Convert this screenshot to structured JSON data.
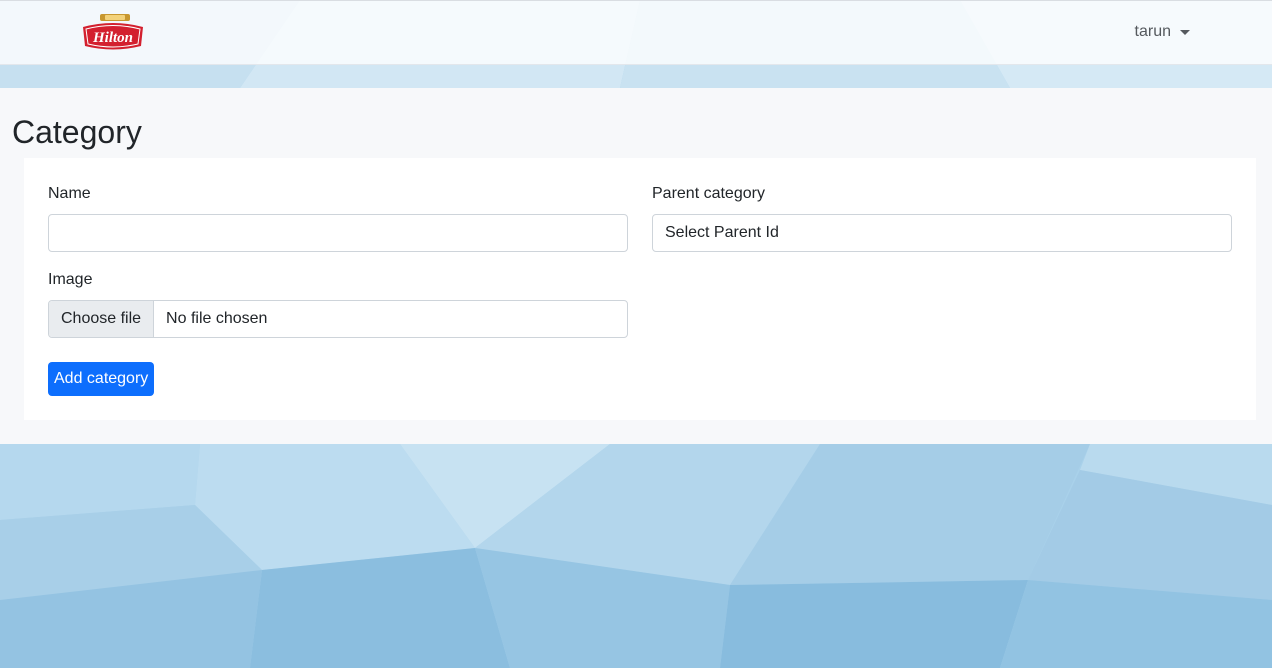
{
  "navbar": {
    "brand": "Hilton",
    "user": "tarun",
    "logo_icon": "hilton-logo"
  },
  "page": {
    "title": "Category"
  },
  "form": {
    "name_label": "Name",
    "name_value": "",
    "parent_label": "Parent category",
    "parent_value": "Select Parent Id",
    "image_label": "Image",
    "file_button": "Choose file",
    "file_status": "No file chosen",
    "submit_label": "Add category"
  },
  "colors": {
    "primary": "#0d6efd",
    "logo_red": "#d3202f",
    "logo_gold": "#c7972f",
    "background_blue": "#8fc3e2"
  }
}
